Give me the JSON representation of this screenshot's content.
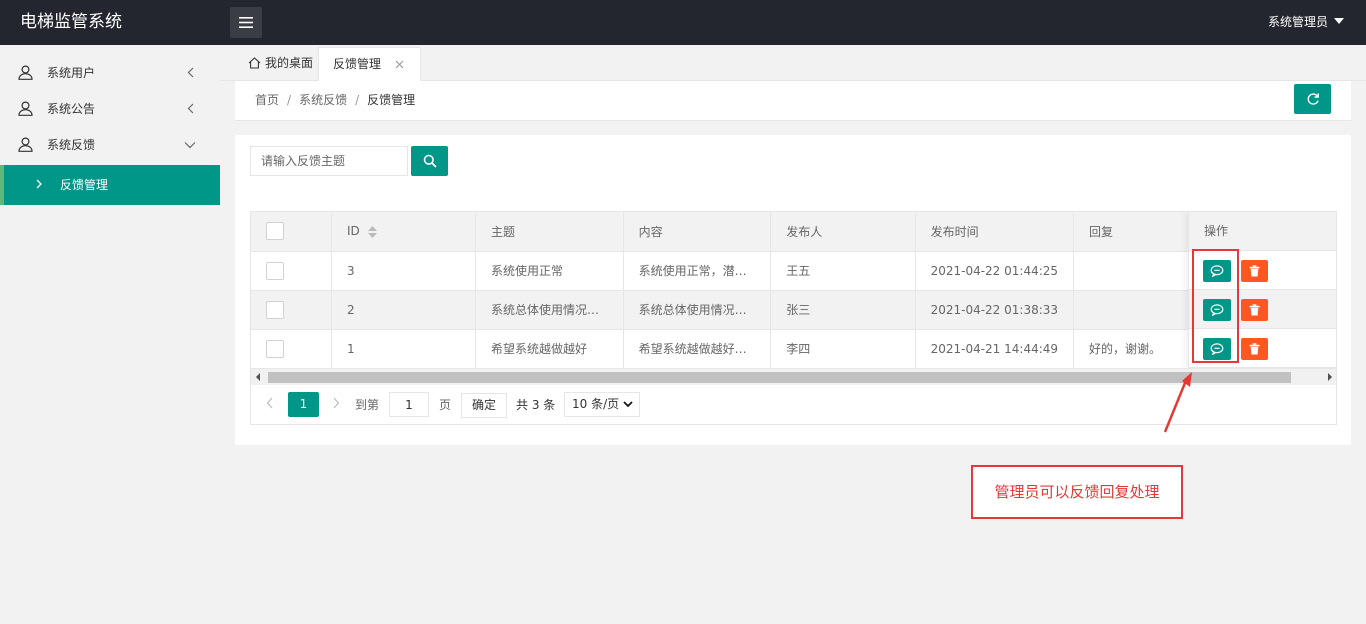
{
  "app": {
    "title": "电梯监管系统",
    "user": "系统管理员"
  },
  "sidebar": {
    "items": [
      {
        "label": "系统用户"
      },
      {
        "label": "系统公告"
      },
      {
        "label": "系统反馈"
      }
    ],
    "active_sub": "反馈管理"
  },
  "tabs": [
    {
      "label": "我的桌面"
    },
    {
      "label": "反馈管理"
    }
  ],
  "breadcrumb": [
    "首页",
    "系统反馈",
    "反馈管理"
  ],
  "search": {
    "placeholder": "请输入反馈主题",
    "value": ""
  },
  "table": {
    "headers": [
      "ID",
      "主题",
      "内容",
      "发布人",
      "发布时间",
      "回复",
      "操作"
    ],
    "rows": [
      {
        "id": "3",
        "subject": "系统使用正常",
        "content": "系统使用正常，潜…",
        "author": "王五",
        "time": "2021-04-22 01:44:25",
        "reply": ""
      },
      {
        "id": "2",
        "subject": "系统总体使用情况…",
        "content": "系统总体使用情况…",
        "author": "张三",
        "time": "2021-04-22 01:38:33",
        "reply": ""
      },
      {
        "id": "1",
        "subject": "希望系统越做越好",
        "content": "希望系统越做越好…",
        "author": "李四",
        "time": "2021-04-21 14:44:49",
        "reply": "好的，谢谢。"
      }
    ]
  },
  "pagination": {
    "current": "1",
    "goto_label": "到第",
    "goto_value": "1",
    "page_label": "页",
    "confirm_label": "确定",
    "total_label": "共 3 条",
    "page_size": "10 条/页"
  },
  "annotation": {
    "note": "管理员可以反馈回复处理"
  },
  "colors": {
    "header": "#23262e",
    "primary": "#009688",
    "danger": "#ff5722",
    "annotation": "#e53935"
  }
}
